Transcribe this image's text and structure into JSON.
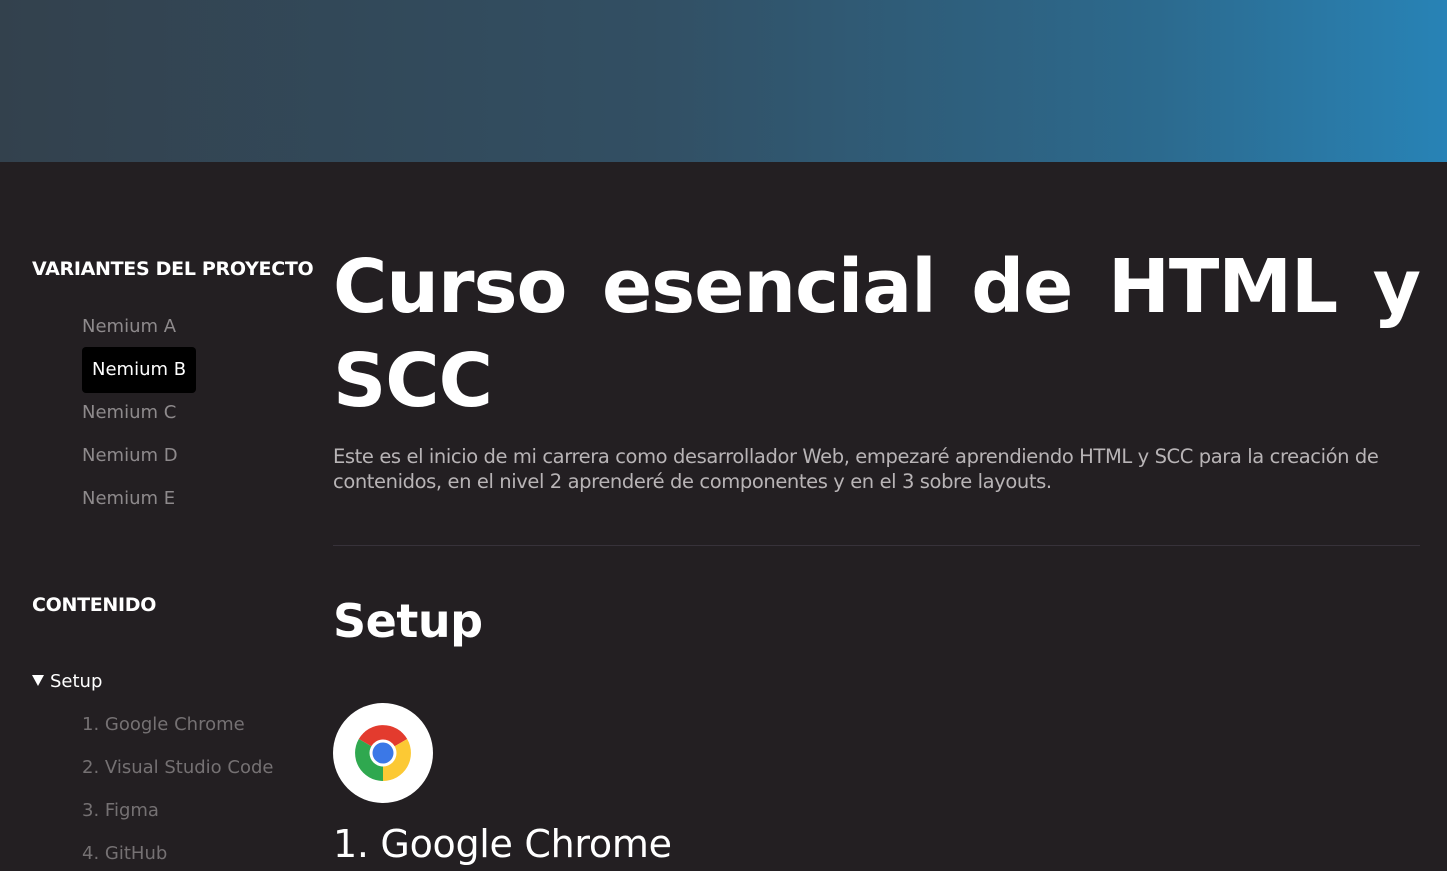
{
  "sidebar": {
    "variants_heading": "VARIANTES DEL PROYECTO",
    "variants": [
      {
        "label": "Nemium A",
        "active": false
      },
      {
        "label": "Nemium B",
        "active": true
      },
      {
        "label": "Nemium C",
        "active": false
      },
      {
        "label": "Nemium D",
        "active": false
      },
      {
        "label": "Nemium E",
        "active": false
      }
    ],
    "contents_heading": "CONTENIDO",
    "toc": {
      "group_label": "Setup",
      "expanded": true,
      "items": [
        {
          "label": "1. Google Chrome"
        },
        {
          "label": "2. Visual Studio Code"
        },
        {
          "label": "3. Figma"
        },
        {
          "label": "4. GitHub"
        }
      ]
    }
  },
  "main": {
    "title": "Curso esencial de HTML y SCC",
    "intro": "Este es el inicio de mi carrera como desarrollador Web, empezaré aprendiendo HTML y SCC para la creación de contenidos, en el nivel 2 aprenderé de componentes y en el 3 sobre layouts.",
    "section_title": "Setup",
    "subsection": {
      "icon": "chrome-logo-icon",
      "title": "1. Google Chrome"
    }
  },
  "colors": {
    "page_background": "#231f22",
    "banner_left": "#33414d",
    "banner_right": "#2883b6",
    "active_item_background": "#000000"
  }
}
